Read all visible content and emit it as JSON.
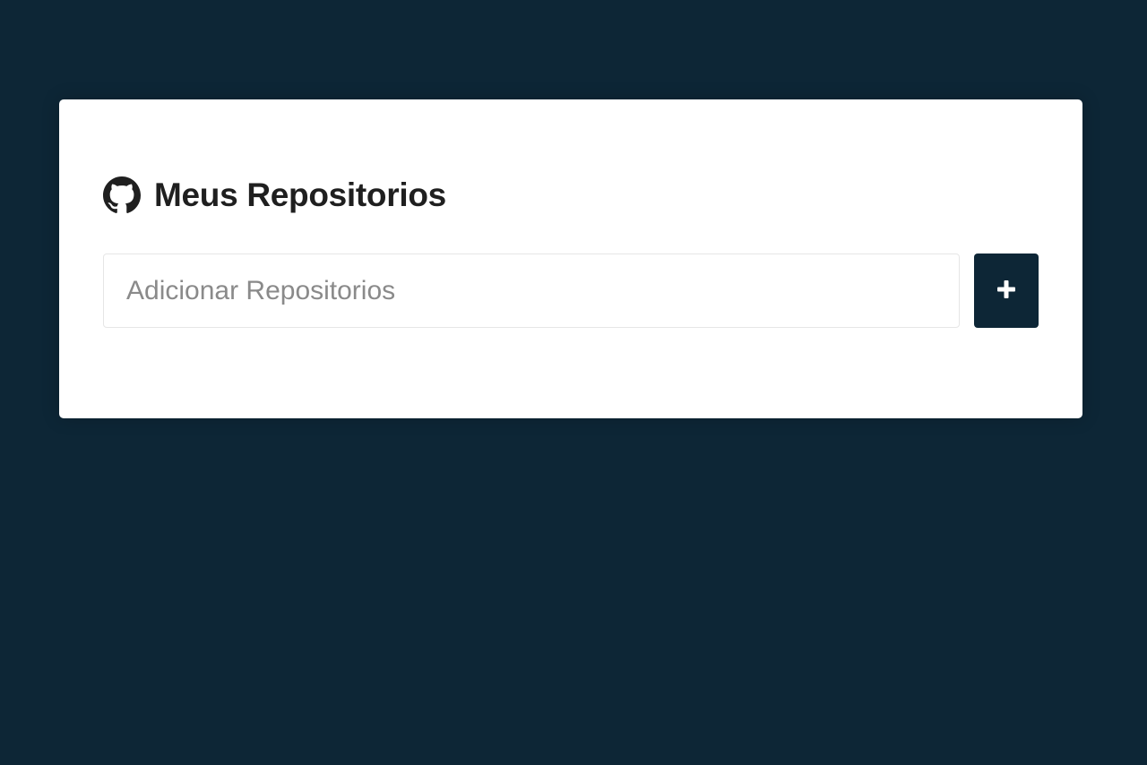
{
  "header": {
    "icon": "github-icon",
    "title": "Meus Repositorios"
  },
  "form": {
    "input_value": "",
    "input_placeholder": "Adicionar Repositorios",
    "add_button_icon": "plus-icon"
  },
  "colors": {
    "background": "#0d2636",
    "card": "#ffffff",
    "button": "#0d2636",
    "title": "#1f1f1f"
  }
}
